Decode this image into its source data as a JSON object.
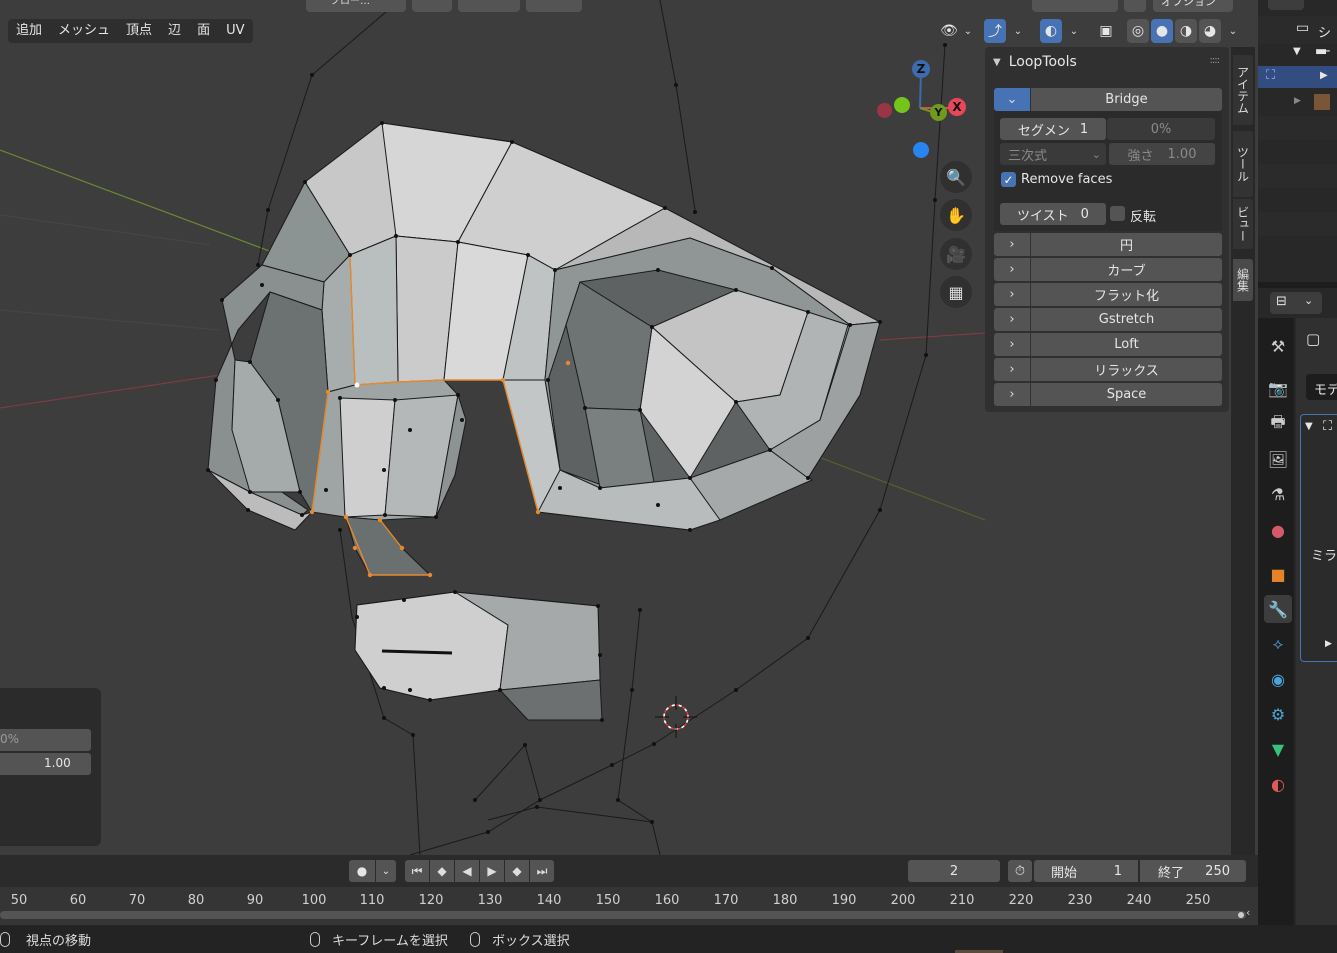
{
  "viewport": {
    "menu": [
      "追加",
      "メッシュ",
      "頂点",
      "辺",
      "面",
      "UV"
    ],
    "top_partial_label": "フロー…",
    "top_right_label": "オプション",
    "axes": {
      "x": "X",
      "y": "Y",
      "z": "Z"
    }
  },
  "loop_tools": {
    "title": "LoopTools",
    "bridge": {
      "label": "Bridge",
      "segments_label": "セグメン",
      "segments_value": "1",
      "percent": "0%",
      "interp": "三次式",
      "strength_label": "強さ",
      "strength_value": "1.00",
      "remove_faces": "Remove faces",
      "twist_label": "ツイスト",
      "twist_value": "0",
      "reverse": "反転"
    },
    "tools": [
      "円",
      "カーブ",
      "フラット化",
      "Gstretch",
      "Loft",
      "リラックス",
      "Space"
    ]
  },
  "side_tabs": [
    "アイテム",
    "ツール",
    "ビュー",
    "編集"
  ],
  "redo_panel": {
    "percent": "0%",
    "value": "1.00"
  },
  "outliner": {
    "scene_label": "シー"
  },
  "properties": {
    "mode_label": "モデ",
    "mirror_label": "ミラ"
  },
  "timeline": {
    "current_frame": "2",
    "start_label": "開始",
    "start_value": "1",
    "end_label": "終了",
    "end_value": "250",
    "ticks": [
      "50",
      "60",
      "70",
      "80",
      "90",
      "100",
      "110",
      "120",
      "130",
      "140",
      "150",
      "160",
      "170",
      "180",
      "190",
      "200",
      "210",
      "220",
      "230",
      "240",
      "250"
    ]
  },
  "status": {
    "move_view": "視点の移動",
    "select_keyframe": "キーフレームを選択",
    "box_select": "ボックス選択"
  }
}
